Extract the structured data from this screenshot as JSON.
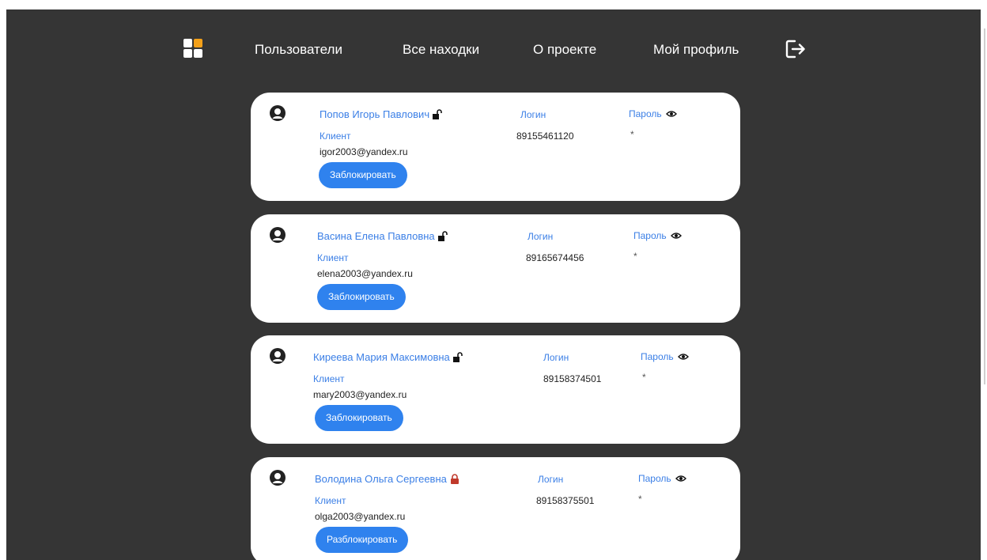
{
  "nav": {
    "users": "Пользователи",
    "finds": "Все находки",
    "about": "О проекте",
    "profile": "Мой профиль"
  },
  "colors": {
    "background": "#353535",
    "accent": "#3b7fe6",
    "button": "#2f82ee",
    "logo_orange": "#f4a11a",
    "locked": "#c0392b"
  },
  "users": [
    {
      "name": "Попов Игорь Павлович",
      "lock_icon": "unlocked-icon",
      "role": "Клиент",
      "email": "igor2003@yandex.ru",
      "login_label": "Логин",
      "login": "89155461120",
      "password_label": "Пароль",
      "password": "*",
      "action": "Заблокировать"
    },
    {
      "name": "Васина Елена Павловна",
      "lock_icon": "unlocked-icon",
      "role": "Клиент",
      "email": "elena2003@yandex.ru",
      "login_label": "Логин",
      "login": "89165674456",
      "password_label": "Пароль",
      "password": "*",
      "action": "Заблокировать"
    },
    {
      "name": "Киреева Мария Максимовна",
      "lock_icon": "unlocked-icon",
      "role": "Клиент",
      "email": "mary2003@yandex.ru",
      "login_label": "Логин",
      "login": "89158374501",
      "password_label": "Пароль",
      "password": "*",
      "action": "Заблокировать"
    },
    {
      "name": "Володина Ольга Сергеевна",
      "lock_icon": "locked-icon",
      "role": "Клиент",
      "email": "olga2003@yandex.ru",
      "login_label": "Логин",
      "login": "89158375501",
      "password_label": "Пароль",
      "password": "*",
      "action": "Разблокировать"
    }
  ]
}
